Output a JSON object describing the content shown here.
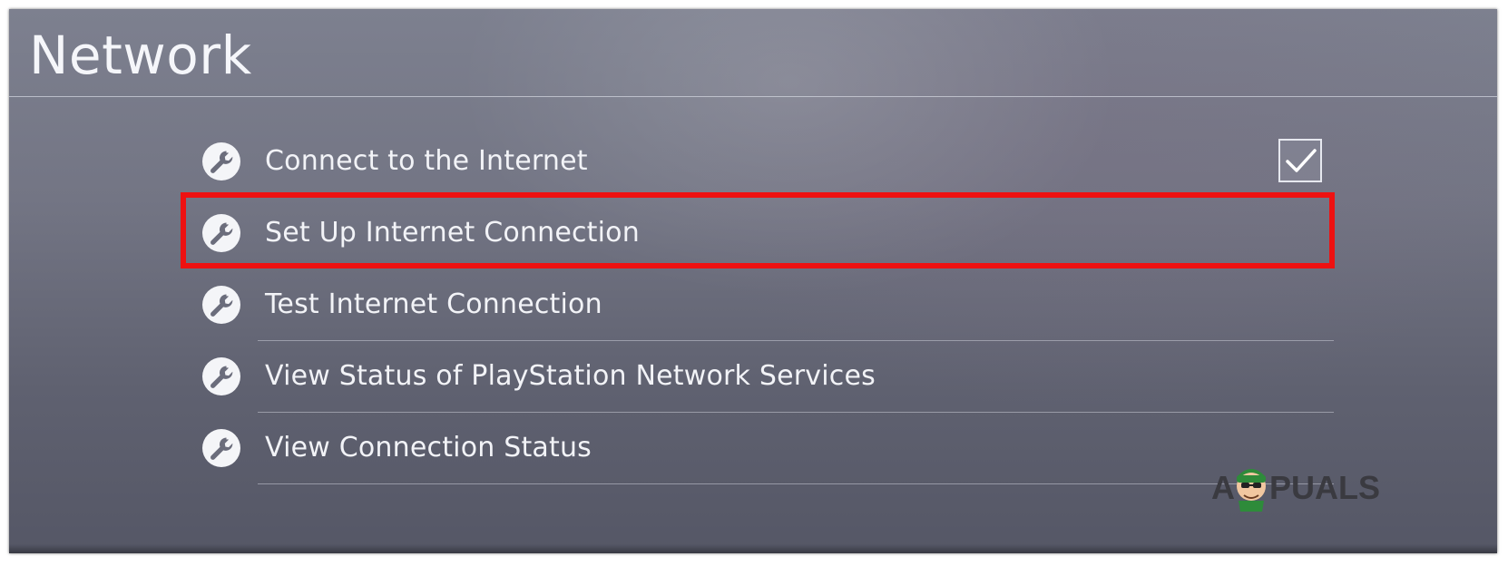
{
  "screen": {
    "title": "Network"
  },
  "menu": {
    "items": [
      {
        "label": "Connect to the Internet",
        "icon": "wrench-icon",
        "checked": true
      },
      {
        "label": "Set Up Internet Connection",
        "icon": "wrench-icon",
        "highlighted": true
      },
      {
        "label": "Test Internet Connection",
        "icon": "wrench-icon"
      },
      {
        "label": "View Status of PlayStation Network Services",
        "icon": "wrench-icon"
      },
      {
        "label": "View Connection Status",
        "icon": "wrench-icon"
      }
    ]
  },
  "annotation": {
    "highlight_color": "#ee1111"
  },
  "watermark": {
    "text": "APPUALS",
    "icon": "appuals-mascot-logo"
  },
  "colors": {
    "background": "#737584",
    "text": "#f2f3f7"
  }
}
